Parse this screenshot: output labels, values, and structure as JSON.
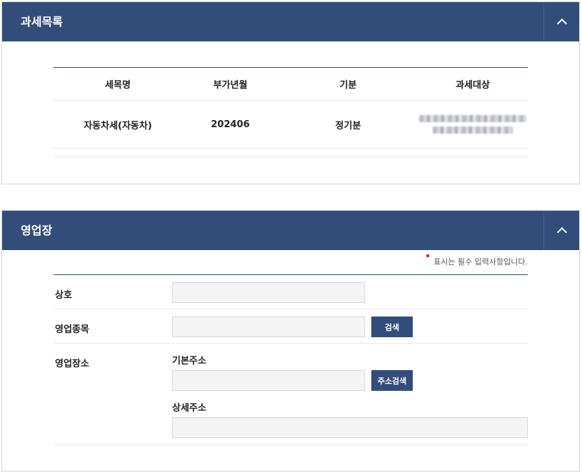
{
  "tax_section": {
    "title": "과세목록",
    "columns": [
      "세목명",
      "부가년월",
      "기분",
      "과세대상"
    ],
    "rows": [
      {
        "tax_item": "자동차세(자동차)",
        "period": "202406",
        "type": "정기분",
        "target": ""
      }
    ]
  },
  "business_section": {
    "title": "영업장",
    "required_note": "표시는 필수 입력사항입니다.",
    "fields": {
      "name_label": "상호",
      "category_label": "영업종목",
      "search_button": "검색",
      "location_label": "영업장소",
      "base_address_label": "기본주소",
      "address_search_button": "주소검색",
      "detail_address_label": "상세주소"
    }
  },
  "colors": {
    "header": "#334d7a",
    "input_bg": "#f4f4f4",
    "required": "#e0002a"
  }
}
